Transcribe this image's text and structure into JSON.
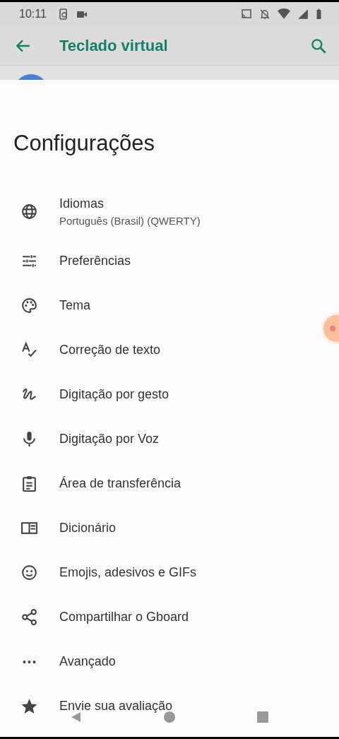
{
  "status_bar": {
    "time": "10:11"
  },
  "app_bar": {
    "title": "Teclado virtual"
  },
  "sheet": {
    "heading": "Configurações",
    "items": [
      {
        "title": "Idiomas",
        "subtitle": "Português (Brasil) (QWERTY)"
      },
      {
        "title": "Preferências"
      },
      {
        "title": "Tema"
      },
      {
        "title": "Correção de texto"
      },
      {
        "title": "Digitação por gesto"
      },
      {
        "title": "Digitação por Voz"
      },
      {
        "title": "Área de transferência"
      },
      {
        "title": "Dicionário"
      },
      {
        "title": "Emojis, adesivos e GIFs"
      },
      {
        "title": "Compartilhar o Gboard"
      },
      {
        "title": "Avançado"
      },
      {
        "title": "Envie sua avaliação"
      }
    ]
  }
}
